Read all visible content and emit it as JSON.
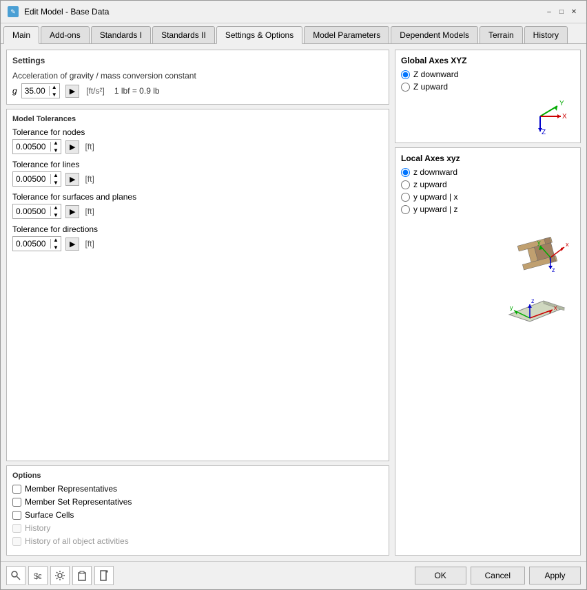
{
  "window": {
    "title": "Edit Model - Base Data",
    "icon": "✎"
  },
  "tabs": [
    {
      "id": "main",
      "label": "Main",
      "active": false
    },
    {
      "id": "addons",
      "label": "Add-ons",
      "active": false
    },
    {
      "id": "standards1",
      "label": "Standards I",
      "active": false
    },
    {
      "id": "standards2",
      "label": "Standards II",
      "active": false
    },
    {
      "id": "settings",
      "label": "Settings & Options",
      "active": true
    },
    {
      "id": "model_params",
      "label": "Model Parameters",
      "active": false
    },
    {
      "id": "dependent",
      "label": "Dependent Models",
      "active": false
    },
    {
      "id": "terrain",
      "label": "Terrain",
      "active": false
    },
    {
      "id": "history",
      "label": "History",
      "active": false
    }
  ],
  "settings": {
    "title": "Settings",
    "gravity_label": "Acceleration of gravity / mass conversion constant",
    "g_symbol": "g",
    "gravity_value": "35.00",
    "gravity_unit": "[ft/s²]",
    "conversion": "1 lbf = 0.9 lb"
  },
  "model_tolerances": {
    "title": "Model Tolerances",
    "tolerances": [
      {
        "label": "Tolerance for nodes",
        "value": "0.00500",
        "unit": "[ft]"
      },
      {
        "label": "Tolerance for lines",
        "value": "0.00500",
        "unit": "[ft]"
      },
      {
        "label": "Tolerance for surfaces and planes",
        "value": "0.00500",
        "unit": "[ft]"
      },
      {
        "label": "Tolerance for directions",
        "value": "0.00500",
        "unit": "[ft]"
      }
    ]
  },
  "options": {
    "title": "Options",
    "items": [
      {
        "label": "Member Representatives",
        "checked": false,
        "disabled": false
      },
      {
        "label": "Member Set Representatives",
        "checked": false,
        "disabled": false
      },
      {
        "label": "Surface Cells",
        "checked": false,
        "disabled": false
      },
      {
        "label": "History",
        "checked": false,
        "disabled": true
      },
      {
        "label": "History of all object activities",
        "checked": false,
        "disabled": true
      }
    ]
  },
  "global_axes": {
    "title": "Global Axes XYZ",
    "options": [
      {
        "label": "Z downward",
        "selected": true
      },
      {
        "label": "Z upward",
        "selected": false
      }
    ]
  },
  "local_axes": {
    "title": "Local Axes xyz",
    "options": [
      {
        "label": "z downward",
        "selected": true
      },
      {
        "label": "z upward",
        "selected": false
      },
      {
        "label": "y upward | x",
        "selected": false
      },
      {
        "label": "y upward | z",
        "selected": false
      }
    ]
  },
  "buttons": {
    "ok": "OK",
    "cancel": "Cancel",
    "apply": "Apply"
  },
  "bottom_icons": [
    "🔍",
    "💱",
    "⚙",
    "📋",
    "📄"
  ]
}
